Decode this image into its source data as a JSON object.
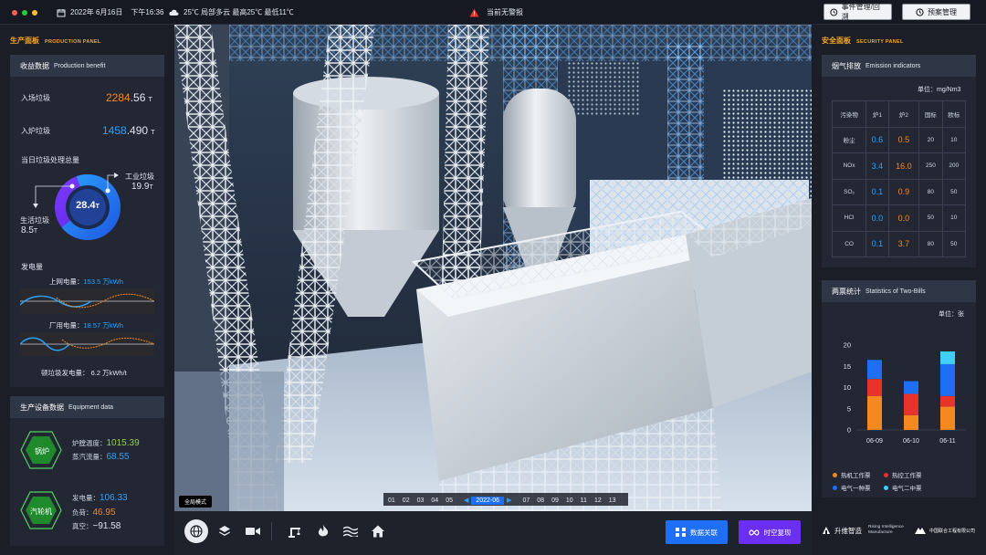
{
  "topbar": {
    "date": "2022年 6月16日",
    "time": "下午16:36",
    "weather": "25℃ 局部多云 最高25℃ 最低11℃",
    "alarm": "当前无警报",
    "btn_events": "事件管理/回溯",
    "btn_plans": "预案管理"
  },
  "left_panel": {
    "title": "生产面板",
    "title_en": "PRODUCTION PANEL",
    "benefit": {
      "title": "收益数据",
      "title_en": "Production benefit",
      "intake_label": "入场垃圾",
      "intake_int": "2284",
      "intake_dec": ".56",
      "intake_unit": "T",
      "furnace_label": "入炉垃圾",
      "furnace_int": "1458",
      "furnace_dec": ".490",
      "furnace_unit": "T",
      "daily_label": "当日垃圾处理总量",
      "donut_total": "28.4",
      "donut_unit": "T",
      "industrial_label": "工业垃圾",
      "industrial_value": "19.9",
      "industrial_unit": "T",
      "domestic_label": "生活垃圾",
      "domestic_value": "8.5",
      "domestic_unit": "T",
      "donut_share": {
        "industrial": 19.9,
        "domestic": 8.5
      },
      "power_label": "发电量",
      "grid_label": "上网电量：",
      "grid_value": "153.5",
      "grid_unit": "万kWh",
      "plant_label": "厂用电量：",
      "plant_value": "18.57",
      "plant_unit": "万kWh",
      "per_ton": "顿垃圾发电量：  6.2 万kWh/t"
    },
    "equipment": {
      "title": "生产设备数据",
      "title_en": "Equipment data",
      "boiler_name": "锅炉",
      "furnace_temp_label": "炉膛温度：",
      "furnace_temp_value": "1015.39",
      "steam_label": "蒸汽流量：",
      "steam_value": "68.55",
      "turbine_name": "汽轮机",
      "gen_label": "发电量：",
      "gen_value": "106.33",
      "load_label": "负荷：",
      "load_value": "46.95",
      "vacuum_label": "真空：",
      "vacuum_value": "−91.58"
    }
  },
  "right_panel": {
    "title": "安全面板",
    "title_en": "SECURITY PANEL",
    "emission": {
      "title": "烟气排放",
      "title_en": "Emission indicators",
      "unit": "单位：mg/Nm3",
      "headers": [
        "污染物",
        "炉1",
        "炉2",
        "国标",
        "欧标"
      ],
      "rows": [
        [
          "粉尘",
          "0.6",
          "0.5",
          "20",
          "10"
        ],
        [
          "NOx",
          "3.4",
          "16.0",
          "250",
          "200"
        ],
        [
          "SO₂",
          "0.1",
          "0.9",
          "80",
          "50"
        ],
        [
          "HCl",
          "0.0",
          "0.0",
          "50",
          "10"
        ],
        [
          "CO",
          "0.1",
          "3.7",
          "80",
          "50"
        ]
      ]
    },
    "bills": {
      "title": "两票统计",
      "title_en": "Statistics of Two-Bills",
      "unit": "单位：张",
      "legend": [
        "热机工作票",
        "热控工作票",
        "电气一种票",
        "电气二中票"
      ]
    }
  },
  "chart_data": {
    "type": "bar",
    "stacked": true,
    "categories": [
      "06-09",
      "06-10",
      "06-11"
    ],
    "ylim": [
      0,
      20
    ],
    "yticks": [
      0,
      5,
      10,
      15,
      20
    ],
    "series": [
      {
        "name": "热机工作票",
        "color": "#f5891f",
        "values": [
          8,
          3.5,
          5.5
        ]
      },
      {
        "name": "热控工作票",
        "color": "#e8322c",
        "values": [
          4,
          5,
          2.5
        ]
      },
      {
        "name": "电气一种票",
        "color": "#1e6ff5",
        "values": [
          4.5,
          3,
          7.5
        ]
      },
      {
        "name": "电气二中票",
        "color": "#3fd0ff",
        "values": [
          0,
          0,
          3
        ]
      }
    ],
    "legend_position": "bottom"
  },
  "timeline": {
    "tooltip": "全局模式",
    "days_before": [
      "01",
      "02",
      "03",
      "04",
      "05"
    ],
    "current": "2022-06",
    "days_after": [
      "07",
      "08",
      "09",
      "10",
      "11",
      "12",
      "13"
    ]
  },
  "bottom_buttons": {
    "data_link": "数据关联",
    "time_replay": "时空复现"
  },
  "brand": {
    "name": "升维智造",
    "tag1": "Rising Intelligence",
    "tag2": "Manufacture",
    "partner": "中国联合工程有限公司"
  },
  "colors": {
    "accent_orange": "#f5a623",
    "accent_blue": "#2aa3ff",
    "accent_green": "#8fd14f",
    "emission_blue": "#2aa3ff",
    "emission_orange": "#f5891f"
  }
}
